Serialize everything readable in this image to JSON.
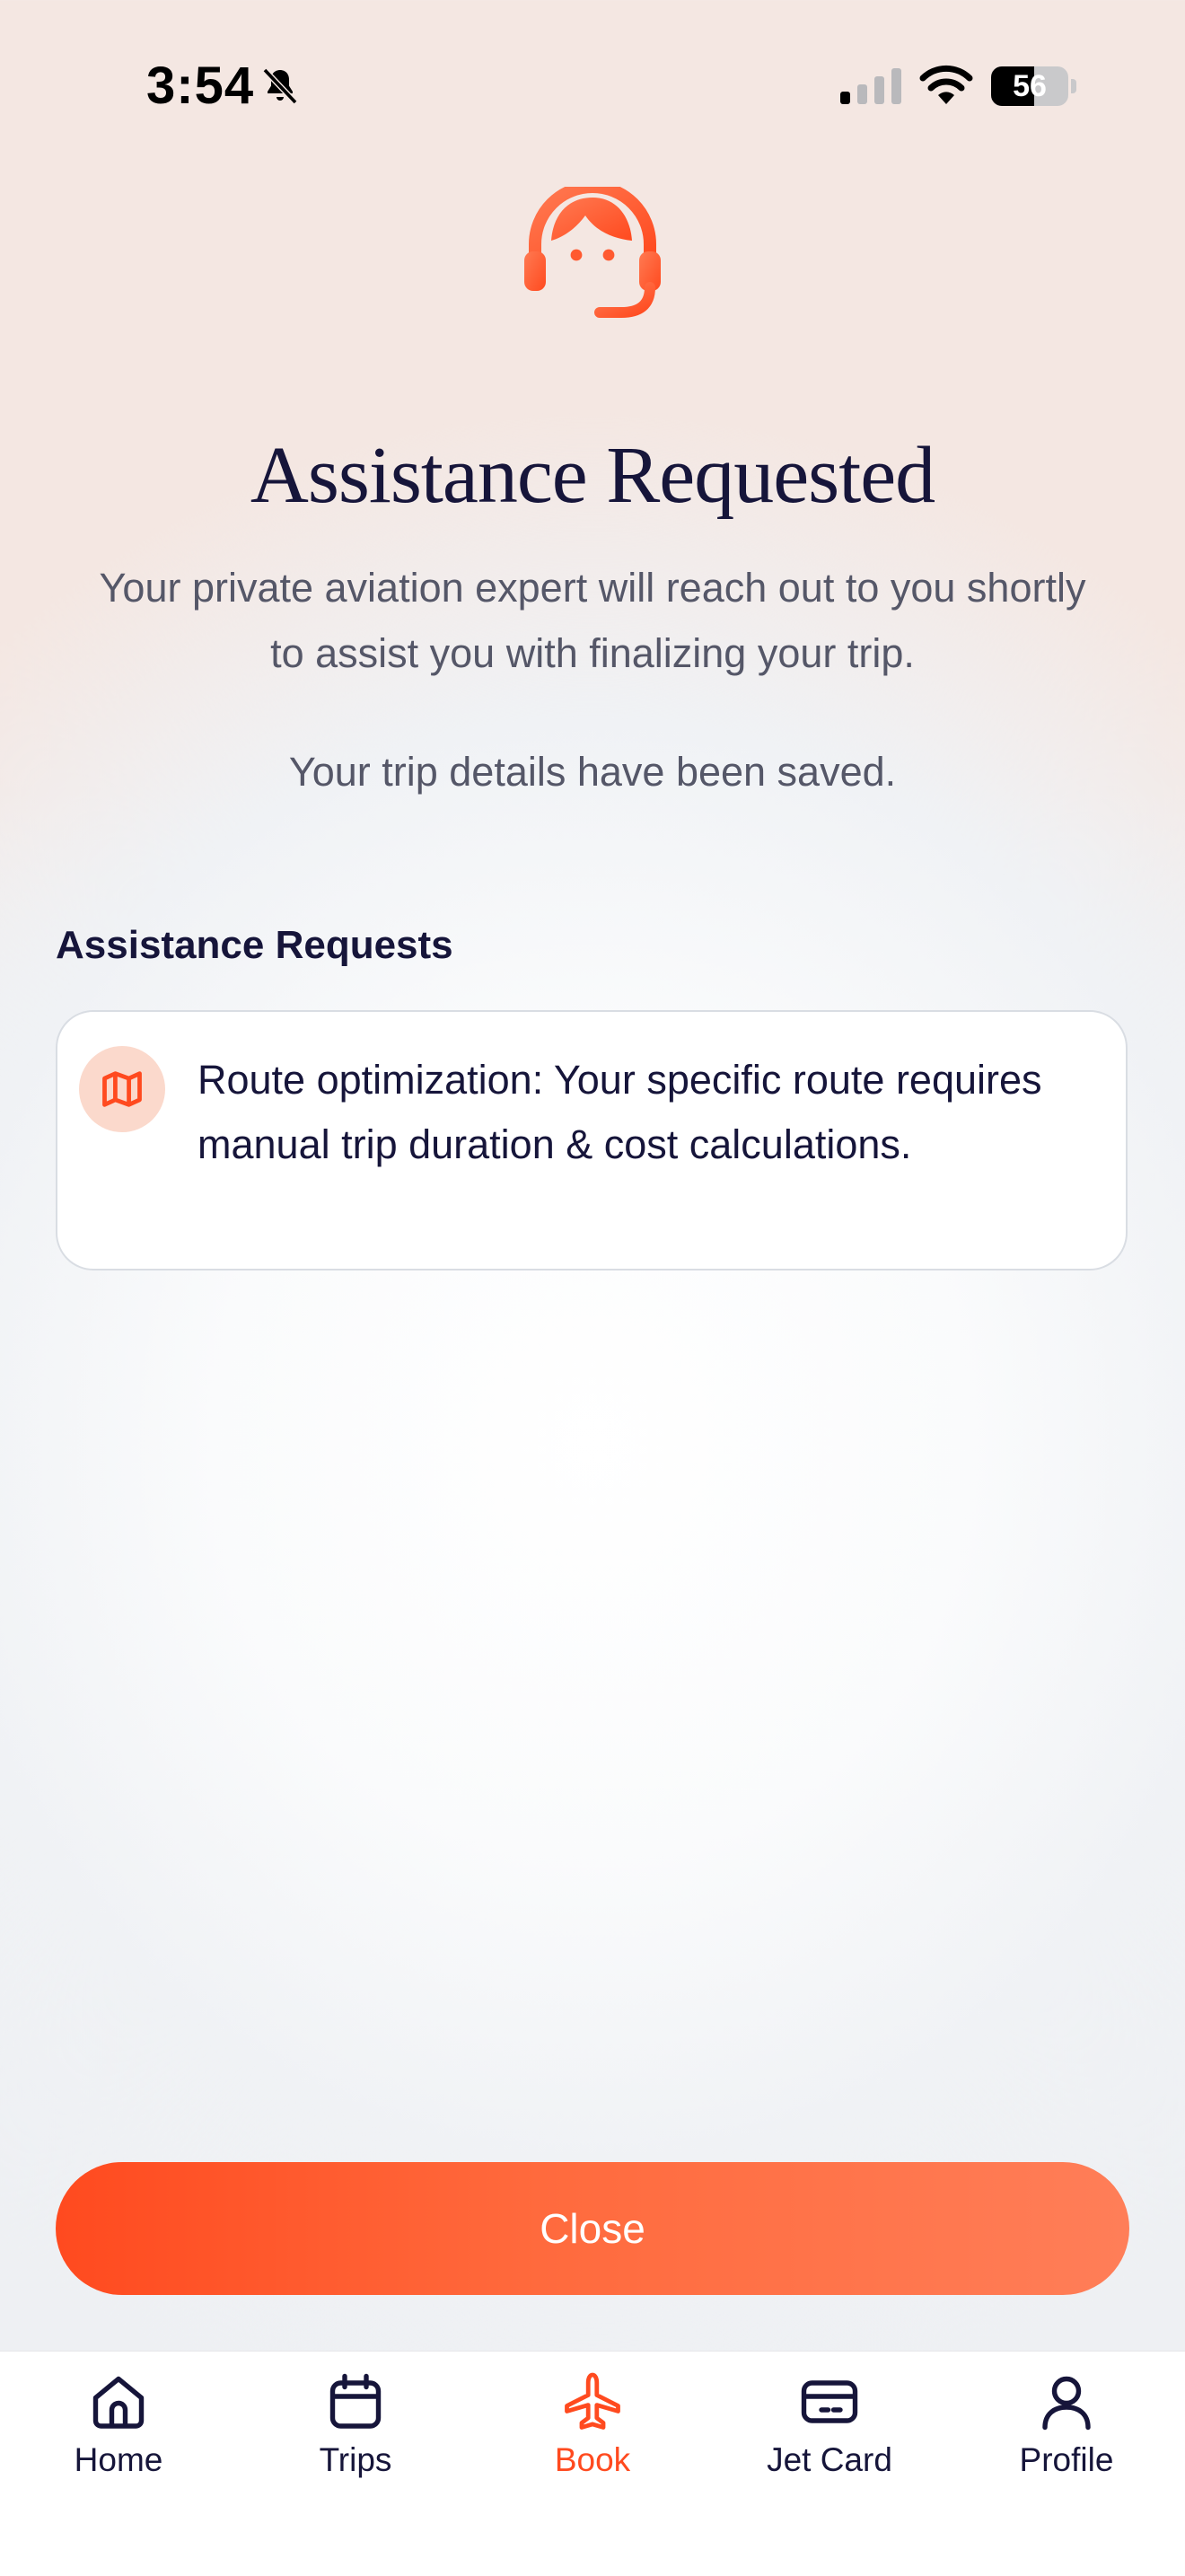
{
  "status_bar": {
    "time": "3:54",
    "battery": "56",
    "battery_level": 0.56,
    "icons": [
      "bell-slash-icon",
      "cellular-signal-icon",
      "wifi-icon",
      "battery-icon"
    ]
  },
  "header": {
    "icon": "customer-support-icon",
    "title": "Assistance Requested",
    "subtitle": "Your private aviation expert will reach out to you shortly to assist you with finalizing your trip.",
    "saved_note": "Your trip details have been saved."
  },
  "assistance": {
    "heading": "Assistance Requests",
    "items": [
      {
        "icon": "map-icon",
        "text": "Route optimization: Your specific route requires manual trip duration & cost calculations."
      }
    ]
  },
  "actions": {
    "close_label": "Close"
  },
  "tab_bar": {
    "tabs": [
      {
        "label": "Home",
        "icon": "home-icon",
        "active": false
      },
      {
        "label": "Trips",
        "icon": "calendar-icon",
        "active": false
      },
      {
        "label": "Book",
        "icon": "airplane-icon",
        "active": true
      },
      {
        "label": "Jet Card",
        "icon": "card-icon",
        "active": false
      },
      {
        "label": "Profile",
        "icon": "user-icon",
        "active": false
      }
    ]
  },
  "colors": {
    "accent": "#ff4a1f",
    "navy": "#16153a",
    "muted_text": "#555768",
    "header_background": "#f4e7e2",
    "icon_bubble": "#fbd9cc"
  }
}
